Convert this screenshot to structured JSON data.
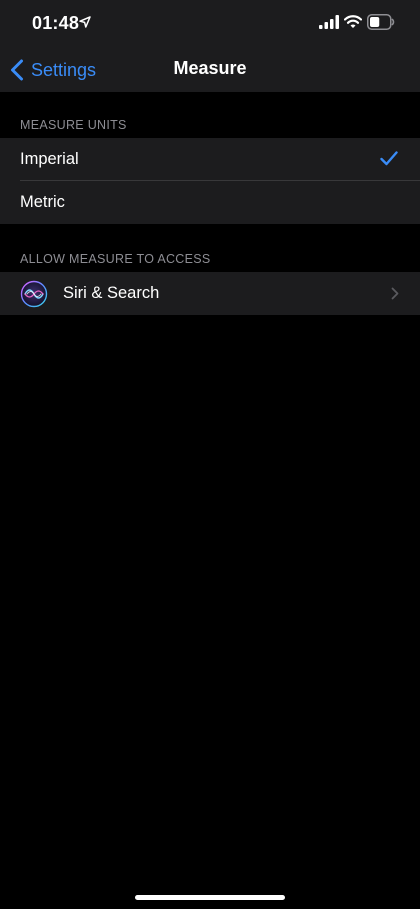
{
  "status_bar": {
    "time": "01:48",
    "location_icon": "location-arrow-icon",
    "signal_icon": "cellular-signal-icon",
    "wifi_icon": "wifi-icon",
    "battery_icon": "battery-icon",
    "battery_level": 0.5
  },
  "nav": {
    "back_label": "Settings",
    "back_icon": "chevron-left-icon",
    "title": "Measure"
  },
  "units_section": {
    "header": "MEASURE UNITS",
    "items": [
      {
        "label": "Imperial",
        "selected": true
      },
      {
        "label": "Metric",
        "selected": false
      }
    ]
  },
  "access_section": {
    "header": "ALLOW MEASURE TO ACCESS",
    "items": [
      {
        "label": "Siri & Search",
        "icon": "siri-icon",
        "accessory": "chevron-right-icon"
      }
    ]
  },
  "colors": {
    "accent": "#3a8cf7",
    "background": "#000000",
    "group_background": "#1c1c1e",
    "separator": "#38383a",
    "secondary_text": "#8d8d93"
  }
}
